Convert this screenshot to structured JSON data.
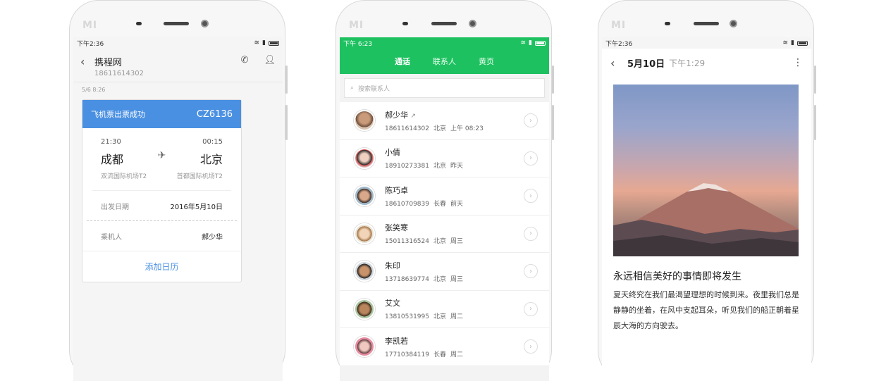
{
  "phone1": {
    "status_time": "下午2:36",
    "brand": "MI",
    "contact_name": "携程网",
    "contact_number": "18611614302",
    "message_time": "5/6 8:26",
    "card": {
      "title": "飞机票出票成功",
      "flight": "CZ6136",
      "depart_time": "21:30",
      "arrive_time": "00:15",
      "depart_city": "成都",
      "arrive_city": "北京",
      "depart_airport": "双流国际机场T2",
      "arrive_airport": "首都国际机场T2",
      "date_label": "出发日期",
      "date_value": "2016年5月10日",
      "passenger_label": "乘机人",
      "passenger_value": "郝少华",
      "add_calendar": "添加日历"
    }
  },
  "phone2": {
    "status_time": "下午 6:23",
    "brand": "MI",
    "tabs": [
      "通话",
      "联系人",
      "黄页"
    ],
    "search_placeholder": "搜索联系人",
    "contacts": [
      {
        "name": "郝少华",
        "number": "18611614302",
        "city": "北京",
        "time": "上午 08:23",
        "outgoing": "↗"
      },
      {
        "name": "小倩",
        "number": "18910273381",
        "city": "北京",
        "time": "昨天"
      },
      {
        "name": "陈巧卓",
        "number": "18610709839",
        "city": "长春",
        "time": "前天"
      },
      {
        "name": "张笑寒",
        "number": "15011316524",
        "city": "北京",
        "time": "周三"
      },
      {
        "name": "朱印",
        "number": "13718639774",
        "city": "北京",
        "time": "周三"
      },
      {
        "name": "艾文",
        "number": "13810531995",
        "city": "北京",
        "time": "周二"
      },
      {
        "name": "李凯若",
        "number": "17710384119",
        "city": "长春",
        "time": "周二"
      }
    ],
    "colors": {
      "accent": "#1ec160"
    }
  },
  "phone3": {
    "status_time": "下午2:36",
    "brand": "MI",
    "date": "5月10日",
    "time": "下午1:29",
    "title": "永远相信美好的事情即将发生",
    "body": "夏天终究在我们最渴望理想的时候到来。夜里我们总是静静的坐着，在风中支起耳朵，听见我们的船正朝着星辰大海的方向驶去。"
  }
}
